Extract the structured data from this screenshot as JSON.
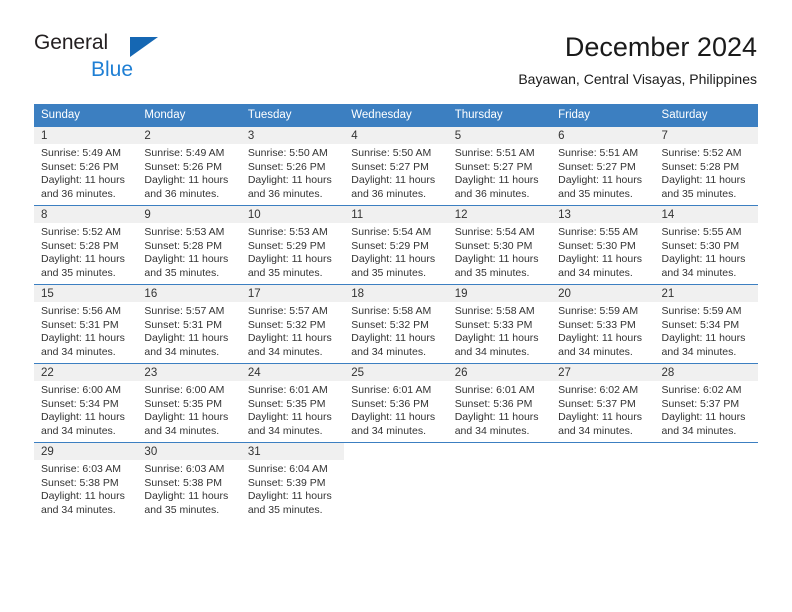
{
  "logo": {
    "word1": "General",
    "word2": "Blue",
    "triangle_color": "#1567b3",
    "word2_color": "#1f7fd4"
  },
  "header": {
    "title": "December 2024",
    "subtitle": "Bayawan, Central Visayas, Philippines"
  },
  "calendar": {
    "header_bg": "#3c7fc1",
    "daynum_bg": "#f0f0f0",
    "weekdays": [
      "Sunday",
      "Monday",
      "Tuesday",
      "Wednesday",
      "Thursday",
      "Friday",
      "Saturday"
    ],
    "weeks": [
      [
        {
          "day": "1",
          "sunrise": "Sunrise: 5:49 AM",
          "sunset": "Sunset: 5:26 PM",
          "daylight1": "Daylight: 11 hours",
          "daylight2": "and 36 minutes."
        },
        {
          "day": "2",
          "sunrise": "Sunrise: 5:49 AM",
          "sunset": "Sunset: 5:26 PM",
          "daylight1": "Daylight: 11 hours",
          "daylight2": "and 36 minutes."
        },
        {
          "day": "3",
          "sunrise": "Sunrise: 5:50 AM",
          "sunset": "Sunset: 5:26 PM",
          "daylight1": "Daylight: 11 hours",
          "daylight2": "and 36 minutes."
        },
        {
          "day": "4",
          "sunrise": "Sunrise: 5:50 AM",
          "sunset": "Sunset: 5:27 PM",
          "daylight1": "Daylight: 11 hours",
          "daylight2": "and 36 minutes."
        },
        {
          "day": "5",
          "sunrise": "Sunrise: 5:51 AM",
          "sunset": "Sunset: 5:27 PM",
          "daylight1": "Daylight: 11 hours",
          "daylight2": "and 36 minutes."
        },
        {
          "day": "6",
          "sunrise": "Sunrise: 5:51 AM",
          "sunset": "Sunset: 5:27 PM",
          "daylight1": "Daylight: 11 hours",
          "daylight2": "and 35 minutes."
        },
        {
          "day": "7",
          "sunrise": "Sunrise: 5:52 AM",
          "sunset": "Sunset: 5:28 PM",
          "daylight1": "Daylight: 11 hours",
          "daylight2": "and 35 minutes."
        }
      ],
      [
        {
          "day": "8",
          "sunrise": "Sunrise: 5:52 AM",
          "sunset": "Sunset: 5:28 PM",
          "daylight1": "Daylight: 11 hours",
          "daylight2": "and 35 minutes."
        },
        {
          "day": "9",
          "sunrise": "Sunrise: 5:53 AM",
          "sunset": "Sunset: 5:28 PM",
          "daylight1": "Daylight: 11 hours",
          "daylight2": "and 35 minutes."
        },
        {
          "day": "10",
          "sunrise": "Sunrise: 5:53 AM",
          "sunset": "Sunset: 5:29 PM",
          "daylight1": "Daylight: 11 hours",
          "daylight2": "and 35 minutes."
        },
        {
          "day": "11",
          "sunrise": "Sunrise: 5:54 AM",
          "sunset": "Sunset: 5:29 PM",
          "daylight1": "Daylight: 11 hours",
          "daylight2": "and 35 minutes."
        },
        {
          "day": "12",
          "sunrise": "Sunrise: 5:54 AM",
          "sunset": "Sunset: 5:30 PM",
          "daylight1": "Daylight: 11 hours",
          "daylight2": "and 35 minutes."
        },
        {
          "day": "13",
          "sunrise": "Sunrise: 5:55 AM",
          "sunset": "Sunset: 5:30 PM",
          "daylight1": "Daylight: 11 hours",
          "daylight2": "and 34 minutes."
        },
        {
          "day": "14",
          "sunrise": "Sunrise: 5:55 AM",
          "sunset": "Sunset: 5:30 PM",
          "daylight1": "Daylight: 11 hours",
          "daylight2": "and 34 minutes."
        }
      ],
      [
        {
          "day": "15",
          "sunrise": "Sunrise: 5:56 AM",
          "sunset": "Sunset: 5:31 PM",
          "daylight1": "Daylight: 11 hours",
          "daylight2": "and 34 minutes."
        },
        {
          "day": "16",
          "sunrise": "Sunrise: 5:57 AM",
          "sunset": "Sunset: 5:31 PM",
          "daylight1": "Daylight: 11 hours",
          "daylight2": "and 34 minutes."
        },
        {
          "day": "17",
          "sunrise": "Sunrise: 5:57 AM",
          "sunset": "Sunset: 5:32 PM",
          "daylight1": "Daylight: 11 hours",
          "daylight2": "and 34 minutes."
        },
        {
          "day": "18",
          "sunrise": "Sunrise: 5:58 AM",
          "sunset": "Sunset: 5:32 PM",
          "daylight1": "Daylight: 11 hours",
          "daylight2": "and 34 minutes."
        },
        {
          "day": "19",
          "sunrise": "Sunrise: 5:58 AM",
          "sunset": "Sunset: 5:33 PM",
          "daylight1": "Daylight: 11 hours",
          "daylight2": "and 34 minutes."
        },
        {
          "day": "20",
          "sunrise": "Sunrise: 5:59 AM",
          "sunset": "Sunset: 5:33 PM",
          "daylight1": "Daylight: 11 hours",
          "daylight2": "and 34 minutes."
        },
        {
          "day": "21",
          "sunrise": "Sunrise: 5:59 AM",
          "sunset": "Sunset: 5:34 PM",
          "daylight1": "Daylight: 11 hours",
          "daylight2": "and 34 minutes."
        }
      ],
      [
        {
          "day": "22",
          "sunrise": "Sunrise: 6:00 AM",
          "sunset": "Sunset: 5:34 PM",
          "daylight1": "Daylight: 11 hours",
          "daylight2": "and 34 minutes."
        },
        {
          "day": "23",
          "sunrise": "Sunrise: 6:00 AM",
          "sunset": "Sunset: 5:35 PM",
          "daylight1": "Daylight: 11 hours",
          "daylight2": "and 34 minutes."
        },
        {
          "day": "24",
          "sunrise": "Sunrise: 6:01 AM",
          "sunset": "Sunset: 5:35 PM",
          "daylight1": "Daylight: 11 hours",
          "daylight2": "and 34 minutes."
        },
        {
          "day": "25",
          "sunrise": "Sunrise: 6:01 AM",
          "sunset": "Sunset: 5:36 PM",
          "daylight1": "Daylight: 11 hours",
          "daylight2": "and 34 minutes."
        },
        {
          "day": "26",
          "sunrise": "Sunrise: 6:01 AM",
          "sunset": "Sunset: 5:36 PM",
          "daylight1": "Daylight: 11 hours",
          "daylight2": "and 34 minutes."
        },
        {
          "day": "27",
          "sunrise": "Sunrise: 6:02 AM",
          "sunset": "Sunset: 5:37 PM",
          "daylight1": "Daylight: 11 hours",
          "daylight2": "and 34 minutes."
        },
        {
          "day": "28",
          "sunrise": "Sunrise: 6:02 AM",
          "sunset": "Sunset: 5:37 PM",
          "daylight1": "Daylight: 11 hours",
          "daylight2": "and 34 minutes."
        }
      ],
      [
        {
          "day": "29",
          "sunrise": "Sunrise: 6:03 AM",
          "sunset": "Sunset: 5:38 PM",
          "daylight1": "Daylight: 11 hours",
          "daylight2": "and 34 minutes."
        },
        {
          "day": "30",
          "sunrise": "Sunrise: 6:03 AM",
          "sunset": "Sunset: 5:38 PM",
          "daylight1": "Daylight: 11 hours",
          "daylight2": "and 35 minutes."
        },
        {
          "day": "31",
          "sunrise": "Sunrise: 6:04 AM",
          "sunset": "Sunset: 5:39 PM",
          "daylight1": "Daylight: 11 hours",
          "daylight2": "and 35 minutes."
        },
        {
          "day": "",
          "sunrise": "",
          "sunset": "",
          "daylight1": "",
          "daylight2": ""
        },
        {
          "day": "",
          "sunrise": "",
          "sunset": "",
          "daylight1": "",
          "daylight2": ""
        },
        {
          "day": "",
          "sunrise": "",
          "sunset": "",
          "daylight1": "",
          "daylight2": ""
        },
        {
          "day": "",
          "sunrise": "",
          "sunset": "",
          "daylight1": "",
          "daylight2": ""
        }
      ]
    ]
  }
}
